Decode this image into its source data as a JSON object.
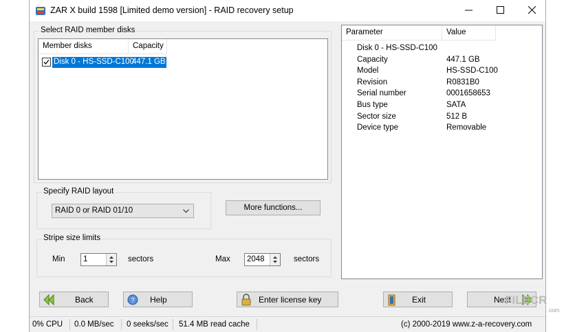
{
  "window": {
    "title": "ZAR X build 1598 [Limited demo version] - RAID recovery setup",
    "minimize": "minimize",
    "maximize": "maximize",
    "close": "close"
  },
  "member_disks": {
    "group_label": "Select RAID member disks",
    "columns": [
      "Member disks",
      "Capacity"
    ],
    "rows": [
      {
        "name": "Disk 0 - HS-SSD-C100",
        "capacity": "447.1 GB",
        "checked": true,
        "selected": true
      }
    ]
  },
  "layout": {
    "group_label": "Specify RAID layout",
    "selected": "RAID 0 or RAID 01/10",
    "more_functions": "More functions..."
  },
  "stripe": {
    "group_label": "Stripe size limits",
    "min_label": "Min",
    "min_value": "1",
    "min_unit": "sectors",
    "max_label": "Max",
    "max_value": "2048",
    "max_unit": "sectors"
  },
  "properties": {
    "columns": [
      "Parameter",
      "Value"
    ],
    "header_row": "Disk 0 - HS-SSD-C100",
    "rows": [
      {
        "param": "Capacity",
        "value": "447.1 GB"
      },
      {
        "param": "Model",
        "value": "HS-SSD-C100"
      },
      {
        "param": "Revision",
        "value": "R0831B0"
      },
      {
        "param": "Serial number",
        "value": "0001658653"
      },
      {
        "param": "Bus type",
        "value": "SATA"
      },
      {
        "param": "Sector size",
        "value": "512 B"
      },
      {
        "param": "Device type",
        "value": "Removable"
      }
    ]
  },
  "buttons": {
    "back": "Back",
    "help": "Help",
    "license": "Enter license key",
    "exit": "Exit",
    "next": "Next"
  },
  "status": {
    "cpu": "0% CPU",
    "speed": "0.0 MB/sec",
    "seeks": "0 seeks/sec",
    "cache": "51.4 MB read cache",
    "copyright": "(c) 2000-2019 www.z-a-recovery.com"
  },
  "watermark": {
    "text": "FILECR",
    "suffix": ".com"
  },
  "colors": {
    "selection": "#0078d7",
    "window_bg": "#f0f0f0"
  }
}
